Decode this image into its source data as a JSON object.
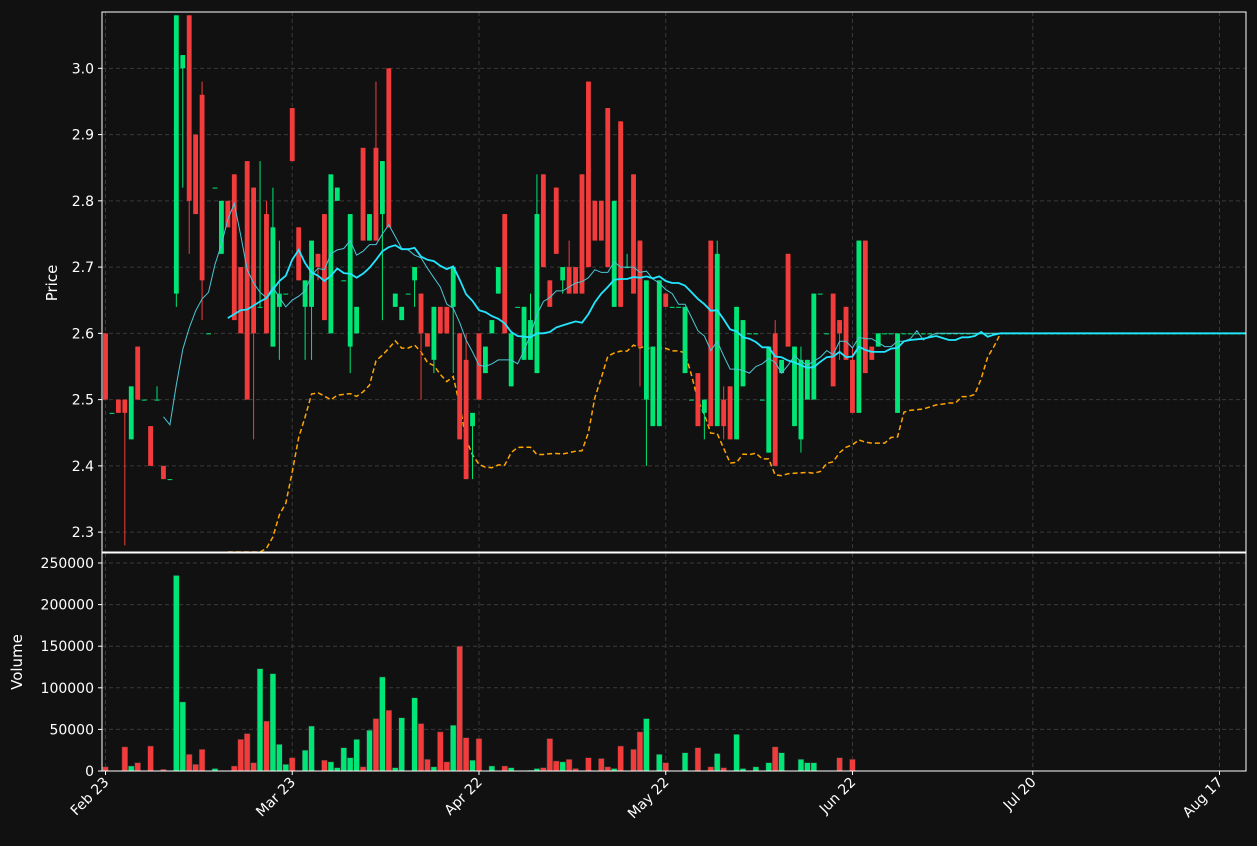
{
  "theme": {
    "background": "#111111",
    "grid": "#3a3a3a",
    "text": "#ffffff",
    "up": "#00e676",
    "down": "#f23c3c",
    "ma_fast": "#22e6ff",
    "ma_slow": "#4cc7d6",
    "band": "#ffa500"
  },
  "chart_data": {
    "type": "candlestick",
    "panels": [
      {
        "name": "price",
        "ylabel": "Price",
        "ylim": [
          2.27,
          3.085
        ],
        "yticks": [
          2.3,
          2.4,
          2.5,
          2.6,
          2.7,
          2.8,
          2.9,
          3.0
        ]
      },
      {
        "name": "volume",
        "ylabel": "Volume",
        "ylim": [
          0,
          262000
        ],
        "yticks": [
          0,
          50000,
          100000,
          150000,
          200000,
          250000
        ]
      }
    ],
    "x_tick_labels": [
      {
        "index": 0,
        "label": "Feb 23"
      },
      {
        "index": 29,
        "label": "Mar 23"
      },
      {
        "index": 58,
        "label": "Apr 22"
      },
      {
        "index": 87,
        "label": "May 22"
      },
      {
        "index": 116,
        "label": "Jun 22"
      },
      {
        "index": 144,
        "label": "Jul 20"
      },
      {
        "index": 173,
        "label": "Aug 17"
      }
    ],
    "grid": true,
    "candles": [
      [
        "Feb 23",
        2.6,
        2.6,
        2.5,
        2.5,
        5000
      ],
      [
        "Feb 24",
        2.48,
        2.48,
        2.48,
        2.48,
        0
      ],
      [
        "Feb 25",
        2.5,
        2.5,
        2.48,
        2.48,
        0
      ],
      [
        "Feb 26",
        2.5,
        2.5,
        2.28,
        2.48,
        29000
      ],
      [
        "Feb 27",
        2.44,
        2.52,
        2.44,
        2.52,
        6000
      ],
      [
        "Feb 28",
        2.58,
        2.58,
        2.5,
        2.5,
        10000
      ],
      [
        "Mar 1",
        2.5,
        2.5,
        2.5,
        2.5,
        0
      ],
      [
        "Mar 2",
        2.46,
        2.46,
        2.4,
        2.4,
        30000
      ],
      [
        "Mar 3",
        2.5,
        2.52,
        2.5,
        2.5,
        0
      ],
      [
        "Mar 4",
        2.4,
        2.4,
        2.38,
        2.38,
        2000
      ],
      [
        "Mar 5",
        2.38,
        2.38,
        2.38,
        2.38,
        0
      ],
      [
        "Mar 6",
        2.66,
        3.08,
        2.64,
        3.08,
        235000
      ],
      [
        "Mar 7",
        3.0,
        3.02,
        2.82,
        3.02,
        83000
      ],
      [
        "Mar 8",
        3.08,
        3.08,
        2.72,
        2.8,
        20000
      ],
      [
        "Mar 9",
        2.9,
        2.9,
        2.78,
        2.78,
        8000
      ],
      [
        "Mar 10",
        2.96,
        2.98,
        2.62,
        2.68,
        26000
      ],
      [
        "Mar 11",
        2.6,
        2.6,
        2.6,
        2.6,
        0
      ],
      [
        "Mar 12",
        2.82,
        2.82,
        2.82,
        2.82,
        3000
      ],
      [
        "Mar 13",
        2.72,
        2.8,
        2.72,
        2.8,
        0
      ],
      [
        "Mar 14",
        2.8,
        2.8,
        2.76,
        2.76,
        0
      ],
      [
        "Mar 15",
        2.84,
        2.84,
        2.62,
        2.62,
        6000
      ],
      [
        "Mar 16",
        2.7,
        2.7,
        2.6,
        2.6,
        38000
      ],
      [
        "Mar 17",
        2.86,
        2.86,
        2.5,
        2.5,
        45000
      ],
      [
        "Mar 18",
        2.82,
        2.82,
        2.44,
        2.6,
        10000
      ],
      [
        "Mar 19",
        2.64,
        2.86,
        2.64,
        2.64,
        123000
      ],
      [
        "Mar 20",
        2.78,
        2.8,
        2.6,
        2.6,
        60000
      ],
      [
        "Mar 21",
        2.58,
        2.82,
        2.58,
        2.76,
        117000
      ],
      [
        "Mar 22",
        2.64,
        2.74,
        2.56,
        2.66,
        32000
      ],
      [
        "Mar 23",
        2.66,
        2.66,
        2.66,
        2.66,
        8000
      ],
      [
        "Mar 24",
        2.94,
        2.94,
        2.86,
        2.86,
        16000
      ],
      [
        "Mar 25",
        2.76,
        2.76,
        2.68,
        2.68,
        0
      ],
      [
        "Mar 26",
        2.64,
        2.68,
        2.56,
        2.68,
        25000
      ],
      [
        "Mar 27",
        2.64,
        2.74,
        2.56,
        2.74,
        54000
      ],
      [
        "Mar 28",
        2.72,
        2.72,
        2.68,
        2.7,
        0
      ],
      [
        "Mar 29",
        2.78,
        2.78,
        2.62,
        2.62,
        13000
      ],
      [
        "Mar 30",
        2.6,
        2.84,
        2.6,
        2.84,
        11000
      ],
      [
        "Mar 31",
        2.8,
        2.82,
        2.8,
        2.82,
        4000
      ],
      [
        "Apr 1",
        2.68,
        2.68,
        2.68,
        2.68,
        28000
      ],
      [
        "Apr 2",
        2.58,
        2.78,
        2.54,
        2.78,
        16000
      ],
      [
        "Apr 3",
        2.6,
        2.64,
        2.6,
        2.64,
        38000
      ],
      [
        "Apr 4",
        2.88,
        2.88,
        2.74,
        2.74,
        5000
      ],
      [
        "Apr 5",
        2.74,
        2.78,
        2.74,
        2.78,
        49000
      ],
      [
        "Apr 6",
        2.88,
        2.98,
        2.74,
        2.74,
        63000
      ],
      [
        "Apr 7",
        2.78,
        2.86,
        2.62,
        2.86,
        113000
      ],
      [
        "Apr 8",
        3.0,
        3.0,
        2.76,
        2.76,
        73000
      ],
      [
        "Apr 9",
        2.64,
        2.66,
        2.64,
        2.66,
        4000
      ],
      [
        "Apr 10",
        2.62,
        2.64,
        2.62,
        2.64,
        64000
      ],
      [
        "Apr 11",
        2.66,
        2.66,
        2.66,
        2.66,
        0
      ],
      [
        "Apr 12",
        2.68,
        2.7,
        2.64,
        2.7,
        88000
      ],
      [
        "Apr 13",
        2.66,
        2.66,
        2.5,
        2.6,
        57000
      ],
      [
        "Apr 14",
        2.6,
        2.6,
        2.58,
        2.58,
        14000
      ],
      [
        "Apr 15",
        2.56,
        2.64,
        2.54,
        2.64,
        5000
      ],
      [
        "Apr 16",
        2.64,
        2.64,
        2.6,
        2.6,
        47000
      ],
      [
        "Apr 17",
        2.64,
        2.64,
        2.6,
        2.6,
        11000
      ],
      [
        "Apr 18",
        2.64,
        2.7,
        2.54,
        2.7,
        55000
      ],
      [
        "Apr 19",
        2.6,
        2.6,
        2.44,
        2.44,
        150000
      ],
      [
        "Apr 20",
        2.56,
        2.6,
        2.38,
        2.38,
        40000
      ],
      [
        "Apr 21",
        2.46,
        2.48,
        2.38,
        2.48,
        13000
      ],
      [
        "Apr 22",
        2.6,
        2.6,
        2.5,
        2.5,
        39000
      ],
      [
        "Apr 23",
        2.54,
        2.58,
        2.54,
        2.58,
        0
      ],
      [
        "Apr 24",
        2.6,
        2.62,
        2.6,
        2.62,
        6000
      ],
      [
        "Apr 25",
        2.66,
        2.7,
        2.66,
        2.7,
        0
      ],
      [
        "Apr 26",
        2.78,
        2.78,
        2.6,
        2.6,
        6000
      ],
      [
        "Apr 27",
        2.52,
        2.6,
        2.52,
        2.6,
        4000
      ],
      [
        "Apr 28",
        2.64,
        2.64,
        2.64,
        2.64,
        0
      ],
      [
        "Apr 29",
        2.56,
        2.64,
        2.56,
        2.64,
        0
      ],
      [
        "Apr 30",
        2.56,
        2.66,
        2.56,
        2.62,
        1000
      ],
      [
        "May 1",
        2.54,
        2.84,
        2.54,
        2.78,
        3000
      ],
      [
        "May 2",
        2.84,
        2.84,
        2.7,
        2.7,
        4000
      ],
      [
        "May 3",
        2.68,
        2.68,
        2.64,
        2.64,
        39000
      ],
      [
        "May 4",
        2.82,
        2.82,
        2.72,
        2.72,
        12000
      ],
      [
        "May 5",
        2.68,
        2.7,
        2.66,
        2.7,
        11000
      ],
      [
        "May 6",
        2.7,
        2.74,
        2.66,
        2.66,
        14000
      ],
      [
        "May 7",
        2.7,
        2.7,
        2.66,
        2.66,
        3000
      ],
      [
        "May 8",
        2.84,
        2.84,
        2.66,
        2.66,
        0
      ],
      [
        "May 9",
        2.98,
        2.98,
        2.7,
        2.7,
        16000
      ],
      [
        "May 10",
        2.8,
        2.8,
        2.74,
        2.74,
        0
      ],
      [
        "May 11",
        2.8,
        2.8,
        2.74,
        2.74,
        15000
      ],
      [
        "May 12",
        2.94,
        2.94,
        2.7,
        2.7,
        5000
      ],
      [
        "May 13",
        2.64,
        2.8,
        2.64,
        2.8,
        3000
      ],
      [
        "May 14",
        2.92,
        2.92,
        2.64,
        2.64,
        30000
      ],
      [
        "May 15",
        2.7,
        2.72,
        2.7,
        2.7,
        0
      ],
      [
        "May 16",
        2.84,
        2.84,
        2.66,
        2.66,
        26000
      ],
      [
        "May 17",
        2.74,
        2.74,
        2.52,
        2.58,
        47000
      ],
      [
        "May 18",
        2.5,
        2.68,
        2.4,
        2.68,
        63000
      ],
      [
        "May 19",
        2.46,
        2.58,
        2.46,
        2.58,
        0
      ],
      [
        "May 20",
        2.46,
        2.68,
        2.46,
        2.68,
        20000
      ],
      [
        "May 21",
        2.66,
        2.66,
        2.64,
        2.64,
        10000
      ],
      [
        "May 22",
        2.64,
        2.64,
        2.64,
        2.64,
        0
      ],
      [
        "May 23",
        2.64,
        2.64,
        2.64,
        2.64,
        0
      ],
      [
        "May 24",
        2.54,
        2.64,
        2.54,
        2.64,
        22000
      ],
      [
        "May 25",
        2.5,
        2.5,
        2.5,
        2.5,
        0
      ],
      [
        "May 26",
        2.54,
        2.54,
        2.46,
        2.46,
        28000
      ],
      [
        "May 27",
        2.48,
        2.5,
        2.44,
        2.5,
        0
      ],
      [
        "May 28",
        2.74,
        2.74,
        2.46,
        2.46,
        5000
      ],
      [
        "May 29",
        2.46,
        2.74,
        2.46,
        2.72,
        21000
      ],
      [
        "May 30",
        2.5,
        2.52,
        2.44,
        2.46,
        4000
      ],
      [
        "May 31",
        2.52,
        2.52,
        2.44,
        2.44,
        0
      ],
      [
        "Jun 1",
        2.44,
        2.64,
        2.44,
        2.64,
        44000
      ],
      [
        "Jun 2",
        2.52,
        2.62,
        2.52,
        2.62,
        3000
      ],
      [
        "Jun 3",
        2.6,
        2.6,
        2.6,
        2.6,
        0
      ],
      [
        "Jun 4",
        2.6,
        2.6,
        2.6,
        2.6,
        5000
      ],
      [
        "Jun 5",
        2.5,
        2.5,
        2.5,
        2.5,
        0
      ],
      [
        "Jun 6",
        2.42,
        2.58,
        2.42,
        2.58,
        10000
      ],
      [
        "Jun 7",
        2.6,
        2.62,
        2.4,
        2.4,
        29000
      ],
      [
        "Jun 8",
        2.54,
        2.56,
        2.54,
        2.56,
        22000
      ],
      [
        "Jun 9",
        2.72,
        2.72,
        2.58,
        2.58,
        0
      ],
      [
        "Jun 10",
        2.46,
        2.58,
        2.46,
        2.58,
        0
      ],
      [
        "Jun 11",
        2.44,
        2.58,
        2.42,
        2.56,
        14000
      ],
      [
        "Jun 12",
        2.5,
        2.56,
        2.5,
        2.56,
        10000
      ],
      [
        "Jun 13",
        2.5,
        2.66,
        2.5,
        2.66,
        10000
      ],
      [
        "Jun 14",
        2.66,
        2.66,
        2.66,
        2.66,
        0
      ],
      [
        "Jun 15",
        2.6,
        2.6,
        2.6,
        2.6,
        0
      ],
      [
        "Jun 16",
        2.66,
        2.66,
        2.52,
        2.52,
        0
      ],
      [
        "Jun 17",
        2.62,
        2.62,
        2.56,
        2.6,
        16000
      ],
      [
        "Jun 18",
        2.64,
        2.64,
        2.56,
        2.56,
        0
      ],
      [
        "Jun 19",
        2.56,
        2.58,
        2.48,
        2.48,
        14000
      ],
      [
        "Jun 20",
        2.48,
        2.74,
        2.48,
        2.74,
        0
      ],
      [
        "Jun 21",
        2.74,
        2.74,
        2.54,
        2.54,
        0
      ],
      [
        "Jun 22",
        2.58,
        2.58,
        2.56,
        2.56,
        0
      ],
      [
        "Jun 23",
        2.58,
        2.6,
        2.58,
        2.6,
        0
      ],
      [
        "Jun 24",
        2.6,
        2.6,
        2.6,
        2.6,
        0
      ],
      [
        "Jun 25",
        2.6,
        2.6,
        2.6,
        2.6,
        0
      ],
      [
        "Jun 26",
        2.48,
        2.6,
        2.48,
        2.6,
        0
      ],
      [
        "Jun 27",
        2.6,
        2.6,
        2.6,
        2.6,
        0
      ],
      [
        "Jun 28",
        2.6,
        2.6,
        2.6,
        2.6,
        0
      ],
      [
        "Jun 29",
        2.6,
        2.6,
        2.6,
        2.6,
        0
      ],
      [
        "Jun 30",
        2.6,
        2.6,
        2.6,
        2.6,
        0
      ],
      [
        "Jul 1",
        2.6,
        2.6,
        2.6,
        2.6,
        0
      ],
      [
        "Jul 2",
        2.6,
        2.6,
        2.6,
        2.6,
        0
      ],
      [
        "Jul 3",
        2.6,
        2.6,
        2.6,
        2.6,
        0
      ],
      [
        "Jul 4",
        2.6,
        2.6,
        2.6,
        2.6,
        0
      ],
      [
        "Jul 5",
        2.6,
        2.6,
        2.6,
        2.6,
        0
      ],
      [
        "Jul 6",
        2.6,
        2.6,
        2.6,
        2.6,
        0
      ],
      [
        "Jul 7",
        2.6,
        2.6,
        2.6,
        2.6,
        0
      ],
      [
        "Jul 8",
        2.6,
        2.6,
        2.6,
        2.6,
        0
      ],
      [
        "Jul 9",
        2.6,
        2.6,
        2.6,
        2.6,
        0
      ],
      [
        "Jul 10",
        2.6,
        2.6,
        2.6,
        2.6,
        0
      ],
      [
        "Jul 11",
        2.6,
        2.6,
        2.6,
        2.6,
        0
      ],
      [
        "Jul 12",
        2.6,
        2.6,
        2.6,
        2.6,
        0
      ],
      [
        "Jul 13",
        2.6,
        2.6,
        2.6,
        2.6,
        0
      ],
      [
        "Jul 14",
        2.6,
        2.6,
        2.6,
        2.6,
        0
      ],
      [
        "Jul 15",
        2.6,
        2.6,
        2.6,
        2.6,
        0
      ],
      [
        "Jul 16",
        2.6,
        2.6,
        2.6,
        2.6,
        0
      ],
      [
        "Jul 17",
        2.6,
        2.6,
        2.6,
        2.6,
        0
      ],
      [
        "Jul 18",
        2.6,
        2.6,
        2.6,
        2.6,
        0
      ],
      [
        "Jul 19",
        2.6,
        2.6,
        2.6,
        2.6,
        0
      ],
      [
        "Jul 20",
        2.6,
        2.6,
        2.6,
        2.6,
        0
      ],
      [
        "Jul 21",
        2.6,
        2.6,
        2.6,
        2.6,
        0
      ],
      [
        "Jul 22",
        2.6,
        2.6,
        2.6,
        2.6,
        0
      ],
      [
        "Jul 23",
        2.6,
        2.6,
        2.6,
        2.6,
        0
      ],
      [
        "Jul 24",
        2.6,
        2.6,
        2.6,
        2.6,
        0
      ],
      [
        "Jul 25",
        2.6,
        2.6,
        2.6,
        2.6,
        0
      ],
      [
        "Jul 26",
        2.6,
        2.6,
        2.6,
        2.6,
        0
      ],
      [
        "Jul 27",
        2.6,
        2.6,
        2.6,
        2.6,
        0
      ],
      [
        "Jul 28",
        2.6,
        2.6,
        2.6,
        2.6,
        0
      ],
      [
        "Jul 29",
        2.6,
        2.6,
        2.6,
        2.6,
        0
      ],
      [
        "Jul 30",
        2.6,
        2.6,
        2.6,
        2.6,
        0
      ],
      [
        "Jul 31",
        2.6,
        2.6,
        2.6,
        2.6,
        0
      ],
      [
        "Aug 1",
        2.6,
        2.6,
        2.6,
        2.6,
        0
      ],
      [
        "Aug 2",
        2.6,
        2.6,
        2.6,
        2.6,
        0
      ],
      [
        "Aug 3",
        2.6,
        2.6,
        2.6,
        2.6,
        0
      ],
      [
        "Aug 4",
        2.6,
        2.6,
        2.6,
        2.6,
        0
      ],
      [
        "Aug 5",
        2.6,
        2.6,
        2.6,
        2.6,
        0
      ],
      [
        "Aug 6",
        2.6,
        2.6,
        2.6,
        2.6,
        0
      ],
      [
        "Aug 7",
        2.6,
        2.6,
        2.6,
        2.6,
        0
      ],
      [
        "Aug 8",
        2.6,
        2.6,
        2.6,
        2.6,
        0
      ],
      [
        "Aug 9",
        2.6,
        2.6,
        2.6,
        2.6,
        0
      ],
      [
        "Aug 10",
        2.6,
        2.6,
        2.6,
        2.6,
        0
      ],
      [
        "Aug 11",
        2.6,
        2.6,
        2.6,
        2.6,
        0
      ],
      [
        "Aug 12",
        2.6,
        2.6,
        2.6,
        2.6,
        0
      ],
      [
        "Aug 13",
        2.6,
        2.6,
        2.6,
        2.6,
        0
      ],
      [
        "Aug 14",
        2.6,
        2.6,
        2.6,
        2.6,
        0
      ],
      [
        "Aug 15",
        2.6,
        2.6,
        2.6,
        2.6,
        0
      ],
      [
        "Aug 16",
        2.6,
        2.6,
        2.6,
        2.6,
        0
      ],
      [
        "Aug 17",
        2.6,
        2.6,
        2.6,
        2.6,
        0
      ],
      [
        "Aug 18",
        2.6,
        2.6,
        2.6,
        2.6,
        0
      ],
      [
        "Aug 19",
        2.6,
        2.6,
        2.6,
        2.6,
        0
      ],
      [
        "Aug 20",
        2.6,
        2.6,
        2.6,
        2.6,
        0
      ]
    ],
    "candle_fields": [
      "date",
      "open",
      "high",
      "low",
      "close",
      "volume"
    ],
    "late_segment_note_free": true
  }
}
